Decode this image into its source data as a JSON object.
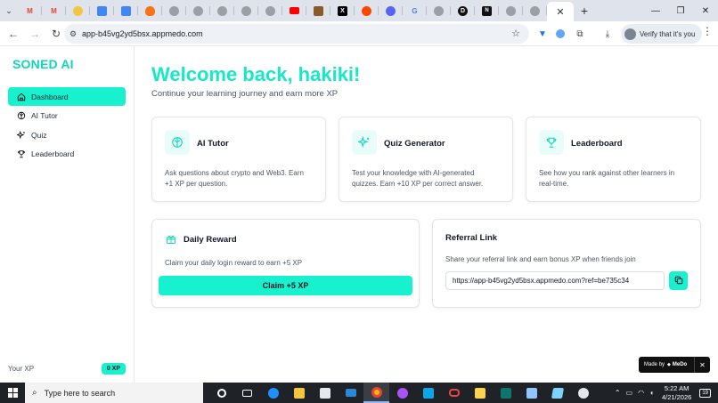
{
  "browser": {
    "active_tab_close": "✕",
    "new_tab": "+",
    "address": "app-b45vg2yd5bsx.appmedo.com",
    "profile_button": "Verify that it's you"
  },
  "app": {
    "brand": "SONED AI",
    "nav": [
      {
        "label": "Dashboard",
        "icon": "home-icon",
        "active": true
      },
      {
        "label": "AI Tutor",
        "icon": "brain-icon",
        "active": false
      },
      {
        "label": "Quiz",
        "icon": "sparkles-icon",
        "active": false
      },
      {
        "label": "Leaderboard",
        "icon": "trophy-icon",
        "active": false
      }
    ],
    "xp_label": "Your XP",
    "xp_value": "0 XP",
    "accent": "#17f1cd"
  },
  "main": {
    "title": "Welcome back, hakiki!",
    "subtitle": "Continue your learning journey and earn more XP",
    "features": [
      {
        "title": "AI Tutor",
        "desc": "Ask questions about crypto and Web3. Earn +1 XP per question."
      },
      {
        "title": "Quiz Generator",
        "desc": "Test your knowledge with AI-generated quizzes. Earn +10 XP per correct answer."
      },
      {
        "title": "Leaderboard",
        "desc": "See how you rank against other learners in real-time."
      }
    ],
    "daily": {
      "title": "Daily Reward",
      "desc": "Claim your daily login reward to earn +5 XP",
      "button": "Claim +5 XP"
    },
    "referral": {
      "title": "Referral Link",
      "desc": "Share your referral link and earn bonus XP when friends join",
      "link": "https://app-b45vg2yd5bsx.appmedo.com?ref=be735c34"
    }
  },
  "badge": {
    "made_by": "Made by",
    "brand": "MeDo",
    "close": "✕"
  },
  "taskbar": {
    "search_placeholder": "Type here to search",
    "time": "5:22 AM",
    "date": "4/21/2026",
    "notifications": "19"
  }
}
